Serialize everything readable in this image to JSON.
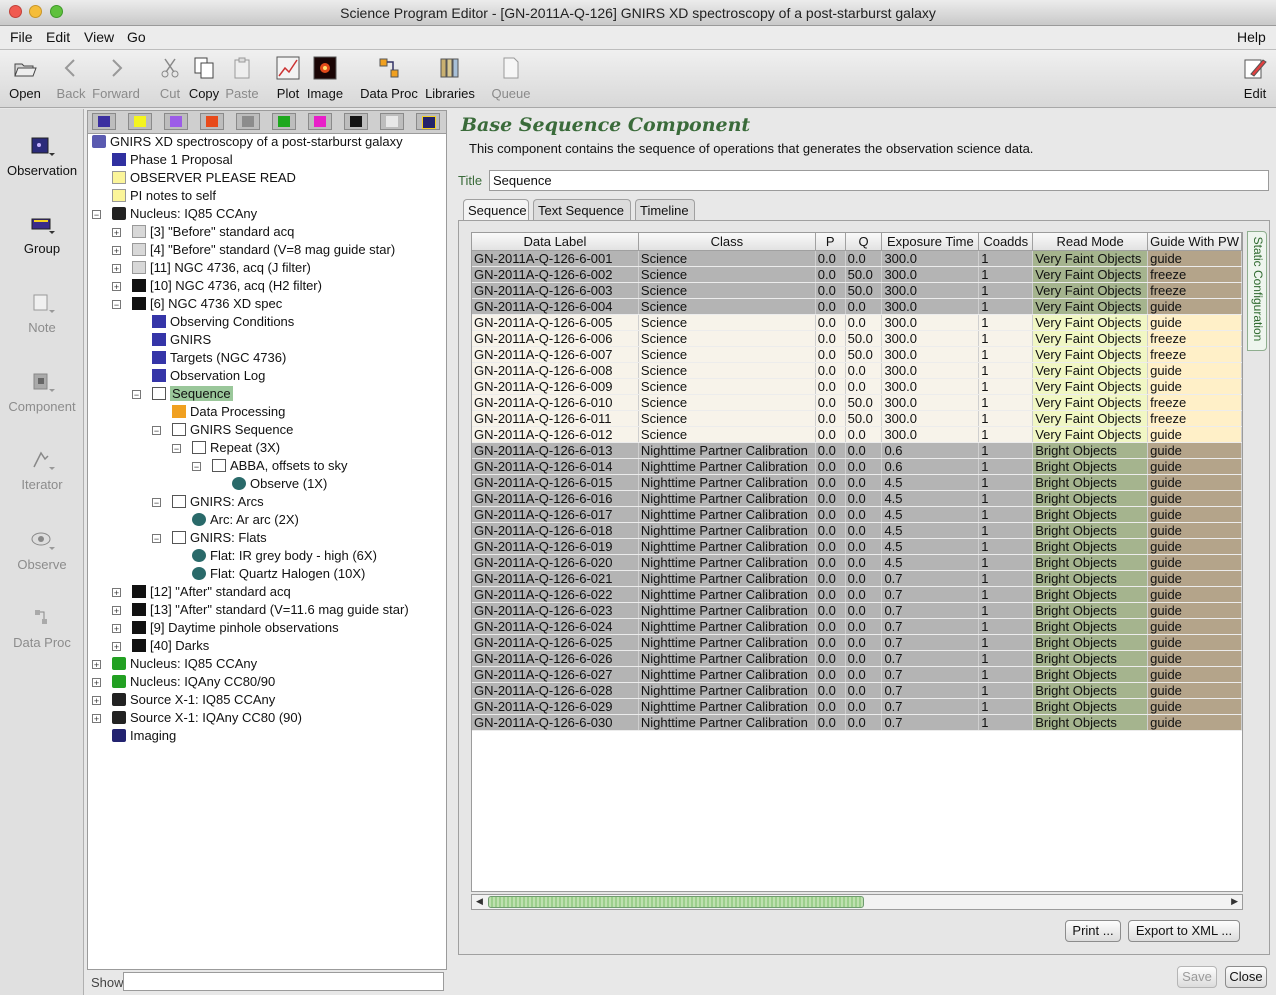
{
  "window": {
    "title": "Science Program Editor - [GN-2011A-Q-126] GNIRS XD spectroscopy of a post-starburst galaxy"
  },
  "menubar": {
    "file": "File",
    "edit": "Edit",
    "view": "View",
    "go": "Go",
    "help": "Help"
  },
  "toolbar": {
    "open": "Open",
    "back": "Back",
    "forward": "Forward",
    "cut": "Cut",
    "copy": "Copy",
    "paste": "Paste",
    "plot": "Plot",
    "image": "Image",
    "data_proc": "Data Proc",
    "libraries": "Libraries",
    "queue": "Queue",
    "edit": "Edit"
  },
  "leftbar": {
    "observation": "Observation",
    "group": "Group",
    "note": "Note",
    "component": "Component",
    "iterator": "Iterator",
    "observe": "Observe",
    "data_proc": "Data Proc"
  },
  "tree": [
    {
      "label": "GNIRS XD spectroscopy of a post-starburst galaxy",
      "icon": "program-icon"
    },
    {
      "label": "Phase 1 Proposal",
      "icon": "phase1-icon"
    },
    {
      "label": "OBSERVER PLEASE READ",
      "icon": "note-icon"
    },
    {
      "label": "PI notes to self",
      "icon": "note-icon"
    },
    {
      "label": "Nucleus: IQ85 CCAny",
      "icon": "folder-icon"
    },
    {
      "label": "[3] \"Before\" standard acq",
      "icon": "observation-icon"
    },
    {
      "label": "[4] \"Before\" standard (V=8 mag guide star)",
      "icon": "observation-icon"
    },
    {
      "label": "[11] NGC 4736, acq (J filter)",
      "icon": "observation-icon"
    },
    {
      "label": "[10] NGC 4736, acq (H2 filter)",
      "icon": "observation-icon"
    },
    {
      "label": "[6] NGC 4736 XD spec",
      "icon": "observation-icon"
    },
    {
      "label": "Observing Conditions",
      "icon": "component-icon"
    },
    {
      "label": "GNIRS",
      "icon": "component-icon"
    },
    {
      "label": "Targets (NGC 4736)",
      "icon": "component-icon"
    },
    {
      "label": "Observation Log",
      "icon": "component-icon"
    },
    {
      "label": "Sequence",
      "icon": "sequence-icon"
    },
    {
      "label": "Data Processing",
      "icon": "dataproc-icon"
    },
    {
      "label": "GNIRS Sequence",
      "icon": "sequence-icon"
    },
    {
      "label": "Repeat (3X)",
      "icon": "sequence-icon"
    },
    {
      "label": "ABBA, offsets to sky",
      "icon": "sequence-icon"
    },
    {
      "label": "Observe (1X)",
      "icon": "observe-icon"
    },
    {
      "label": "GNIRS: Arcs",
      "icon": "sequence-icon"
    },
    {
      "label": "Arc: Ar arc (2X)",
      "icon": "observe-icon"
    },
    {
      "label": "GNIRS: Flats",
      "icon": "sequence-icon"
    },
    {
      "label": "Flat: IR grey body - high (6X)",
      "icon": "observe-icon"
    },
    {
      "label": "Flat: Quartz Halogen (10X)",
      "icon": "observe-icon"
    },
    {
      "label": "[12] \"After\" standard acq",
      "icon": "observation-icon"
    },
    {
      "label": "[13] \"After\" standard (V=11.6 mag guide star)",
      "icon": "observation-icon"
    },
    {
      "label": "[9] Daytime pinhole observations",
      "icon": "observation-icon"
    },
    {
      "label": "[40] Darks",
      "icon": "observation-icon"
    },
    {
      "label": "Nucleus: IQ85 CCAny",
      "icon": "folder-icon"
    },
    {
      "label": "Nucleus: IQAny CC80/90",
      "icon": "folder-icon"
    },
    {
      "label": "Source X-1: IQ85 CCAny",
      "icon": "folder-icon"
    },
    {
      "label": "Source X-1: IQAny CC80 (90)",
      "icon": "folder-icon"
    },
    {
      "label": "Imaging",
      "icon": "folder-icon"
    }
  ],
  "show_label": "Show",
  "component": {
    "title": "Base Sequence Component",
    "description": "This component contains the sequence of operations that generates the observation science data.",
    "title_label": "Title",
    "title_value": "Sequence",
    "tabs": [
      "Sequence",
      "Text Sequence",
      "Timeline"
    ],
    "side_tab": "Static Configuration"
  },
  "table": {
    "columns": [
      "Data Label",
      "Class",
      "P",
      "Q",
      "Exposure Time",
      "Coadds",
      "Read Mode",
      "Guide With PW"
    ],
    "rows": [
      [
        "GN-2011A-Q-126-6-001",
        "Science",
        "0.0",
        "0.0",
        "300.0",
        "1",
        "Very Faint Objects",
        "guide"
      ],
      [
        "GN-2011A-Q-126-6-002",
        "Science",
        "0.0",
        "50.0",
        "300.0",
        "1",
        "Very Faint Objects",
        "freeze"
      ],
      [
        "GN-2011A-Q-126-6-003",
        "Science",
        "0.0",
        "50.0",
        "300.0",
        "1",
        "Very Faint Objects",
        "freeze"
      ],
      [
        "GN-2011A-Q-126-6-004",
        "Science",
        "0.0",
        "0.0",
        "300.0",
        "1",
        "Very Faint Objects",
        "guide"
      ],
      [
        "GN-2011A-Q-126-6-005",
        "Science",
        "0.0",
        "0.0",
        "300.0",
        "1",
        "Very Faint Objects",
        "guide"
      ],
      [
        "GN-2011A-Q-126-6-006",
        "Science",
        "0.0",
        "50.0",
        "300.0",
        "1",
        "Very Faint Objects",
        "freeze"
      ],
      [
        "GN-2011A-Q-126-6-007",
        "Science",
        "0.0",
        "50.0",
        "300.0",
        "1",
        "Very Faint Objects",
        "freeze"
      ],
      [
        "GN-2011A-Q-126-6-008",
        "Science",
        "0.0",
        "0.0",
        "300.0",
        "1",
        "Very Faint Objects",
        "guide"
      ],
      [
        "GN-2011A-Q-126-6-009",
        "Science",
        "0.0",
        "0.0",
        "300.0",
        "1",
        "Very Faint Objects",
        "guide"
      ],
      [
        "GN-2011A-Q-126-6-010",
        "Science",
        "0.0",
        "50.0",
        "300.0",
        "1",
        "Very Faint Objects",
        "freeze"
      ],
      [
        "GN-2011A-Q-126-6-011",
        "Science",
        "0.0",
        "50.0",
        "300.0",
        "1",
        "Very Faint Objects",
        "freeze"
      ],
      [
        "GN-2011A-Q-126-6-012",
        "Science",
        "0.0",
        "0.0",
        "300.0",
        "1",
        "Very Faint Objects",
        "guide"
      ],
      [
        "GN-2011A-Q-126-6-013",
        "Nighttime Partner Calibration",
        "0.0",
        "0.0",
        "0.6",
        "1",
        "Bright Objects",
        "guide"
      ],
      [
        "GN-2011A-Q-126-6-014",
        "Nighttime Partner Calibration",
        "0.0",
        "0.0",
        "0.6",
        "1",
        "Bright Objects",
        "guide"
      ],
      [
        "GN-2011A-Q-126-6-015",
        "Nighttime Partner Calibration",
        "0.0",
        "0.0",
        "4.5",
        "1",
        "Bright Objects",
        "guide"
      ],
      [
        "GN-2011A-Q-126-6-016",
        "Nighttime Partner Calibration",
        "0.0",
        "0.0",
        "4.5",
        "1",
        "Bright Objects",
        "guide"
      ],
      [
        "GN-2011A-Q-126-6-017",
        "Nighttime Partner Calibration",
        "0.0",
        "0.0",
        "4.5",
        "1",
        "Bright Objects",
        "guide"
      ],
      [
        "GN-2011A-Q-126-6-018",
        "Nighttime Partner Calibration",
        "0.0",
        "0.0",
        "4.5",
        "1",
        "Bright Objects",
        "guide"
      ],
      [
        "GN-2011A-Q-126-6-019",
        "Nighttime Partner Calibration",
        "0.0",
        "0.0",
        "4.5",
        "1",
        "Bright Objects",
        "guide"
      ],
      [
        "GN-2011A-Q-126-6-020",
        "Nighttime Partner Calibration",
        "0.0",
        "0.0",
        "4.5",
        "1",
        "Bright Objects",
        "guide"
      ],
      [
        "GN-2011A-Q-126-6-021",
        "Nighttime Partner Calibration",
        "0.0",
        "0.0",
        "0.7",
        "1",
        "Bright Objects",
        "guide"
      ],
      [
        "GN-2011A-Q-126-6-022",
        "Nighttime Partner Calibration",
        "0.0",
        "0.0",
        "0.7",
        "1",
        "Bright Objects",
        "guide"
      ],
      [
        "GN-2011A-Q-126-6-023",
        "Nighttime Partner Calibration",
        "0.0",
        "0.0",
        "0.7",
        "1",
        "Bright Objects",
        "guide"
      ],
      [
        "GN-2011A-Q-126-6-024",
        "Nighttime Partner Calibration",
        "0.0",
        "0.0",
        "0.7",
        "1",
        "Bright Objects",
        "guide"
      ],
      [
        "GN-2011A-Q-126-6-025",
        "Nighttime Partner Calibration",
        "0.0",
        "0.0",
        "0.7",
        "1",
        "Bright Objects",
        "guide"
      ],
      [
        "GN-2011A-Q-126-6-026",
        "Nighttime Partner Calibration",
        "0.0",
        "0.0",
        "0.7",
        "1",
        "Bright Objects",
        "guide"
      ],
      [
        "GN-2011A-Q-126-6-027",
        "Nighttime Partner Calibration",
        "0.0",
        "0.0",
        "0.7",
        "1",
        "Bright Objects",
        "guide"
      ],
      [
        "GN-2011A-Q-126-6-028",
        "Nighttime Partner Calibration",
        "0.0",
        "0.0",
        "0.7",
        "1",
        "Bright Objects",
        "guide"
      ],
      [
        "GN-2011A-Q-126-6-029",
        "Nighttime Partner Calibration",
        "0.0",
        "0.0",
        "0.7",
        "1",
        "Bright Objects",
        "guide"
      ],
      [
        "GN-2011A-Q-126-6-030",
        "Nighttime Partner Calibration",
        "0.0",
        "0.0",
        "0.7",
        "1",
        "Bright Objects",
        "guide"
      ]
    ]
  },
  "buttons": {
    "print": "Print ...",
    "export": "Export to XML ...",
    "save": "Save",
    "close": "Close"
  }
}
